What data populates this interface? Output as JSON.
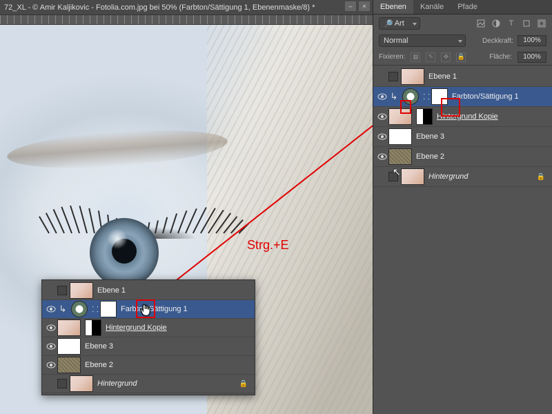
{
  "titlebar": "72_XL - © Amir Kaljikovic - Fotolia.com.jpg bei 50% (Farbton/Sättigung 1, Ebenenmaske/8) *",
  "annotation": "Strg.+E",
  "tabs": {
    "ebenen": "Ebenen",
    "kanale": "Kanäle",
    "pfade": "Pfade"
  },
  "kind": "Art",
  "blend": {
    "mode": "Normal",
    "opacity_label": "Deckkraft:",
    "opacity": "100%"
  },
  "lock": {
    "label": "Fixieren:",
    "fill_label": "Fläche:",
    "fill": "100%"
  },
  "layers_main": [
    {
      "name": "Ebene 1",
      "vis": false,
      "thumb": "face"
    },
    {
      "name": "Farbton/Sättigung 1",
      "vis": true,
      "adj": true,
      "mask": "white",
      "clip": true,
      "sel": true
    },
    {
      "name": "Hintergrund Kopie",
      "vis": true,
      "thumb": "face",
      "mask": "bw",
      "under": true
    },
    {
      "name": "Ebene 3",
      "vis": true,
      "thumb": "white"
    },
    {
      "name": "Ebene 2",
      "vis": true,
      "thumb": "tex"
    },
    {
      "name": "Hintergrund",
      "vis": false,
      "thumb": "face",
      "italic": true,
      "locked": true
    }
  ],
  "layers_callout": [
    {
      "name": "Ebene 1",
      "vis": false,
      "thumb": "face"
    },
    {
      "name": "Farbton/Sättigung 1",
      "vis": true,
      "adj": true,
      "mask": "cursor",
      "clip": true,
      "sel": true
    },
    {
      "name": "Hintergrund Kopie",
      "vis": true,
      "thumb": "face",
      "mask": "bw",
      "under": true
    },
    {
      "name": "Ebene 3",
      "vis": true,
      "thumb": "white"
    },
    {
      "name": "Ebene 2",
      "vis": true,
      "thumb": "tex"
    },
    {
      "name": "Hintergrund",
      "vis": false,
      "thumb": "face",
      "italic": true,
      "locked": true
    }
  ]
}
